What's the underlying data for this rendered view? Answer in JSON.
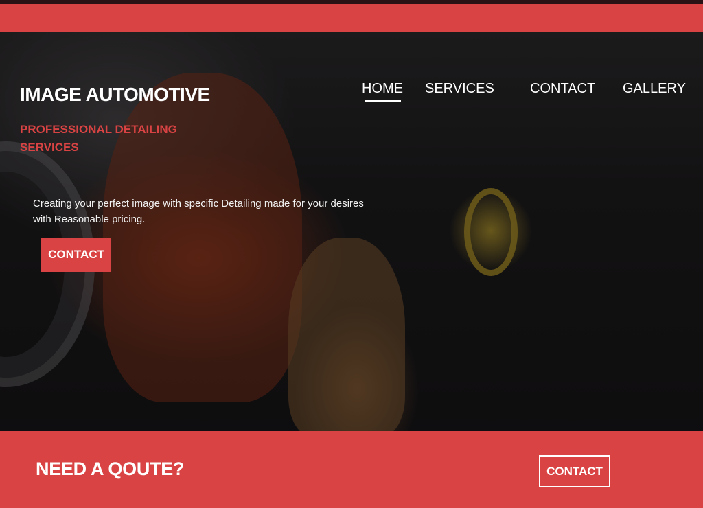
{
  "brand": {
    "name": "IMAGE AUTOMOTIVE",
    "tagline": "PROFESSIONAL DETAILING SERVICES"
  },
  "nav": {
    "items": [
      {
        "label": "HOME",
        "active": true
      },
      {
        "label": "SERVICES",
        "active": false
      },
      {
        "label": "CONTACT",
        "active": false
      },
      {
        "label": "GALLERY",
        "active": false
      }
    ]
  },
  "hero": {
    "description": "Creating your perfect image with specific Detailing made for your desires with Reasonable pricing.",
    "cta_label": "CONTACT"
  },
  "quote_banner": {
    "title": "NEED A QOUTE?",
    "cta_label": "CONTACT"
  },
  "colors": {
    "accent": "#d94343",
    "text": "#ffffff",
    "top_strip": "#2b1214"
  }
}
